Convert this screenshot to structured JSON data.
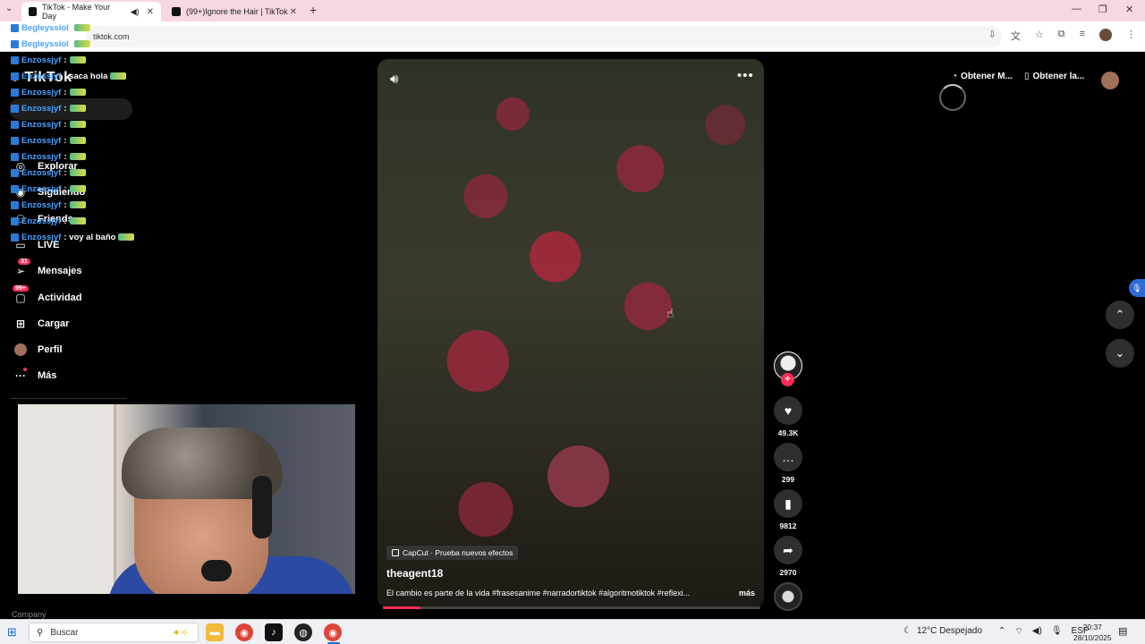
{
  "browser": {
    "tabs": [
      {
        "title": "TikTok - Make Your Day",
        "active": true
      },
      {
        "title": "(99+)Ignore the Hair | TikTok",
        "active": false
      }
    ],
    "url": "tiktok.com"
  },
  "sidebar": {
    "logo": "TikTok",
    "items": [
      {
        "label": "Explorar",
        "icon": "compass-icon"
      },
      {
        "label": "Siguiendo",
        "icon": "following-icon"
      },
      {
        "label": "Friends",
        "icon": "friends-icon"
      },
      {
        "label": "LIVE",
        "icon": "live-icon"
      },
      {
        "label": "Mensajes",
        "icon": "message-icon",
        "badge": "31"
      },
      {
        "label": "Actividad",
        "icon": "activity-icon",
        "badge": "99+"
      },
      {
        "label": "Cargar",
        "icon": "upload-icon"
      },
      {
        "label": "Perfil",
        "icon": "avatar"
      },
      {
        "label": "Más",
        "icon": "more-icon"
      }
    ],
    "footer_label": "Company"
  },
  "chat": [
    {
      "user": "Begleyssiol",
      "msg": ""
    },
    {
      "user": "Begleyssiol",
      "msg": ""
    },
    {
      "user": "Enzossjyf",
      "msg": ":"
    },
    {
      "user": "Enzossjyf",
      "msg": ": saca hola"
    },
    {
      "user": "Enzossjyf",
      "msg": ":"
    },
    {
      "user": "Enzossjyf",
      "msg": ":"
    },
    {
      "user": "Enzossjyf",
      "msg": ":"
    },
    {
      "user": "Enzossjyf",
      "msg": ":"
    },
    {
      "user": "Enzossjyf",
      "msg": ":"
    },
    {
      "user": "Enzossjyf",
      "msg": ":"
    },
    {
      "user": "Enzossjyf",
      "msg": ":"
    },
    {
      "user": "Enzossjyf",
      "msg": ":"
    },
    {
      "user": "Enzossjyf",
      "msg": ":"
    },
    {
      "user": "Enzossjyf",
      "msg": ": voy al baño"
    }
  ],
  "video": {
    "effect_label": "CapCut · Prueba nuevos efectos",
    "author": "theagent18",
    "caption": "El cambio es parte de la vida #frasesanime #narradortiktok #algoritmotiktok #reflexi...",
    "more_label": "más",
    "progress": 0.1,
    "actions": {
      "likes": "49.3K",
      "comments": "299",
      "saves": "9812",
      "shares": "2970"
    }
  },
  "header": {
    "get_app_1": "Obtener M...",
    "get_app_2": "Obtener la..."
  },
  "taskbar": {
    "search_placeholder": "Buscar",
    "weather": "12°C  Despejado",
    "lang": "ESP",
    "time": "20:37",
    "date": "28/10/2025"
  },
  "colors": {
    "brand": "#fe2c55",
    "tab_strip": "#f7d7e1",
    "chat_user": "#4aa3ff"
  }
}
